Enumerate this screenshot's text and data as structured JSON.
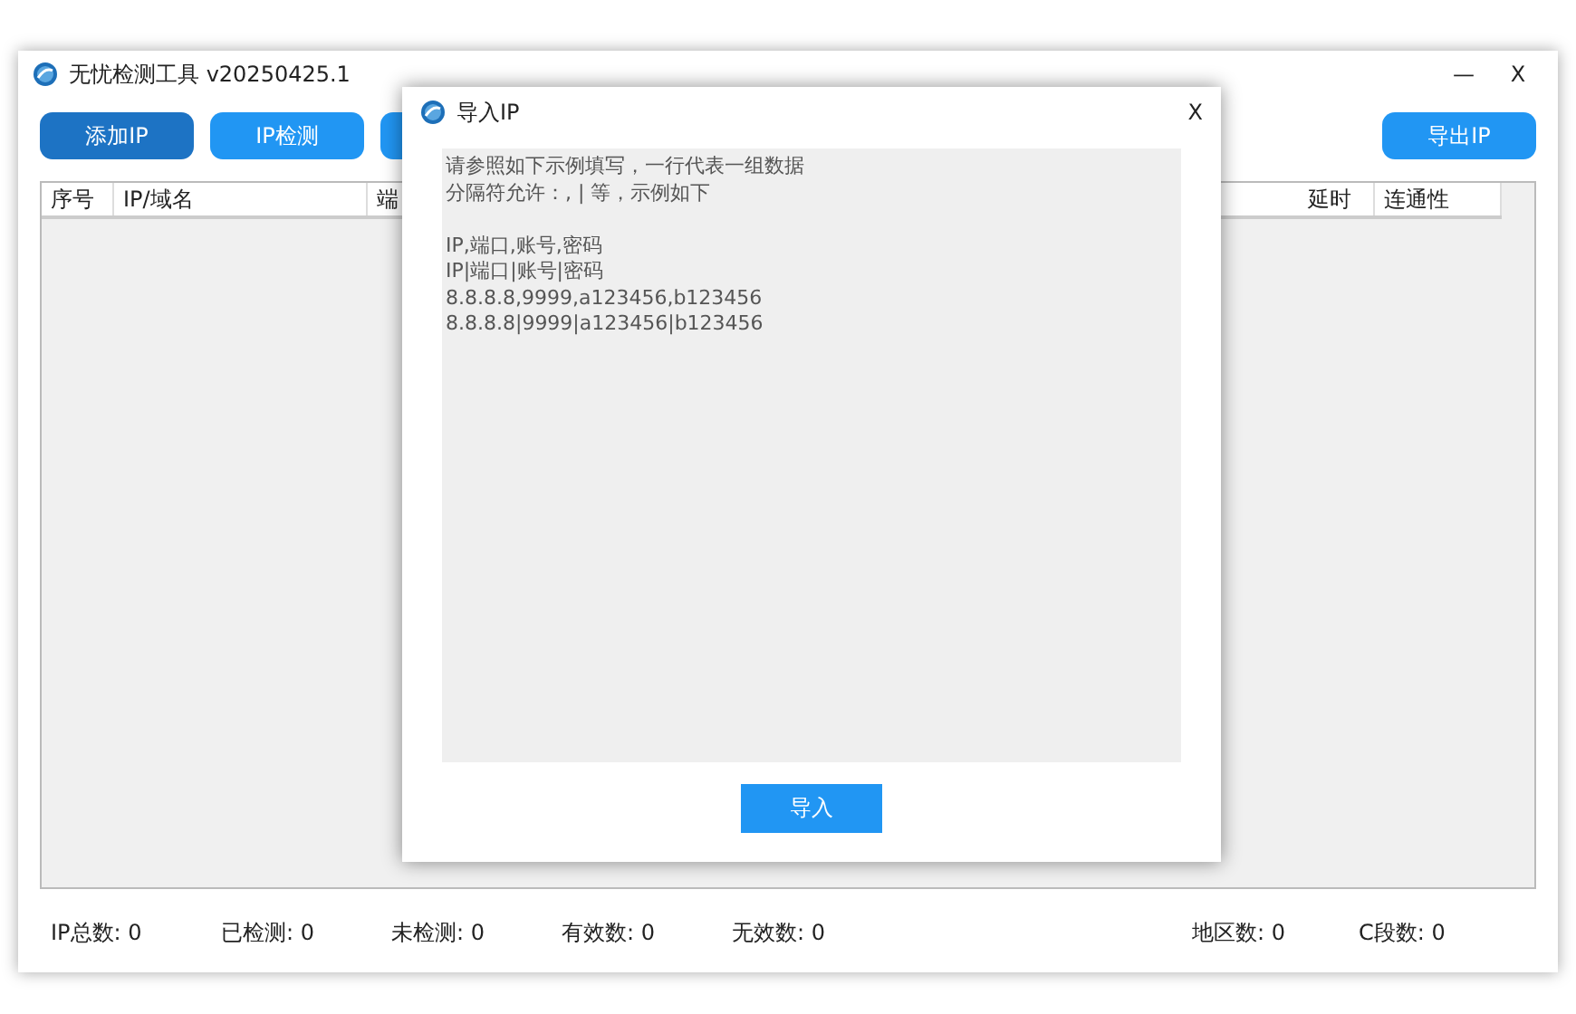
{
  "window": {
    "title": "无忧检测工具 v20250425.1",
    "controls": [
      "—",
      "X"
    ]
  },
  "toolbar": {
    "buttons": [
      {
        "label": "添加IP",
        "selected": true
      },
      {
        "label": "IP检测",
        "selected": false
      },
      {
        "selected": false
      }
    ],
    "right_button": {
      "label": "导出IP"
    }
  },
  "table": {
    "columns_left": [
      "序号",
      "IP/域名",
      "端"
    ],
    "columns_right": [
      "延时",
      "连通性"
    ]
  },
  "status_bar": {
    "left": [
      "IP总数: 0",
      "已检测: 0",
      "未检测: 0",
      "有效数: 0",
      "无效数: 0"
    ],
    "right": [
      "地区数: 0",
      "C段数: 0"
    ]
  },
  "dialog": {
    "title": "导入IP",
    "close": "X",
    "paragraphs": [
      [
        "请参照如下示例填写，一行代表一组数据",
        "分隔符允许：, | 等，示例如下"
      ],
      [
        "IP,端口,账号,密码",
        "IP|端口|账号|密码",
        "8.8.8.8,9999,a123456,b123456",
        "8.8.8.8|9999|a123456|b123456"
      ]
    ],
    "button": "导入"
  }
}
